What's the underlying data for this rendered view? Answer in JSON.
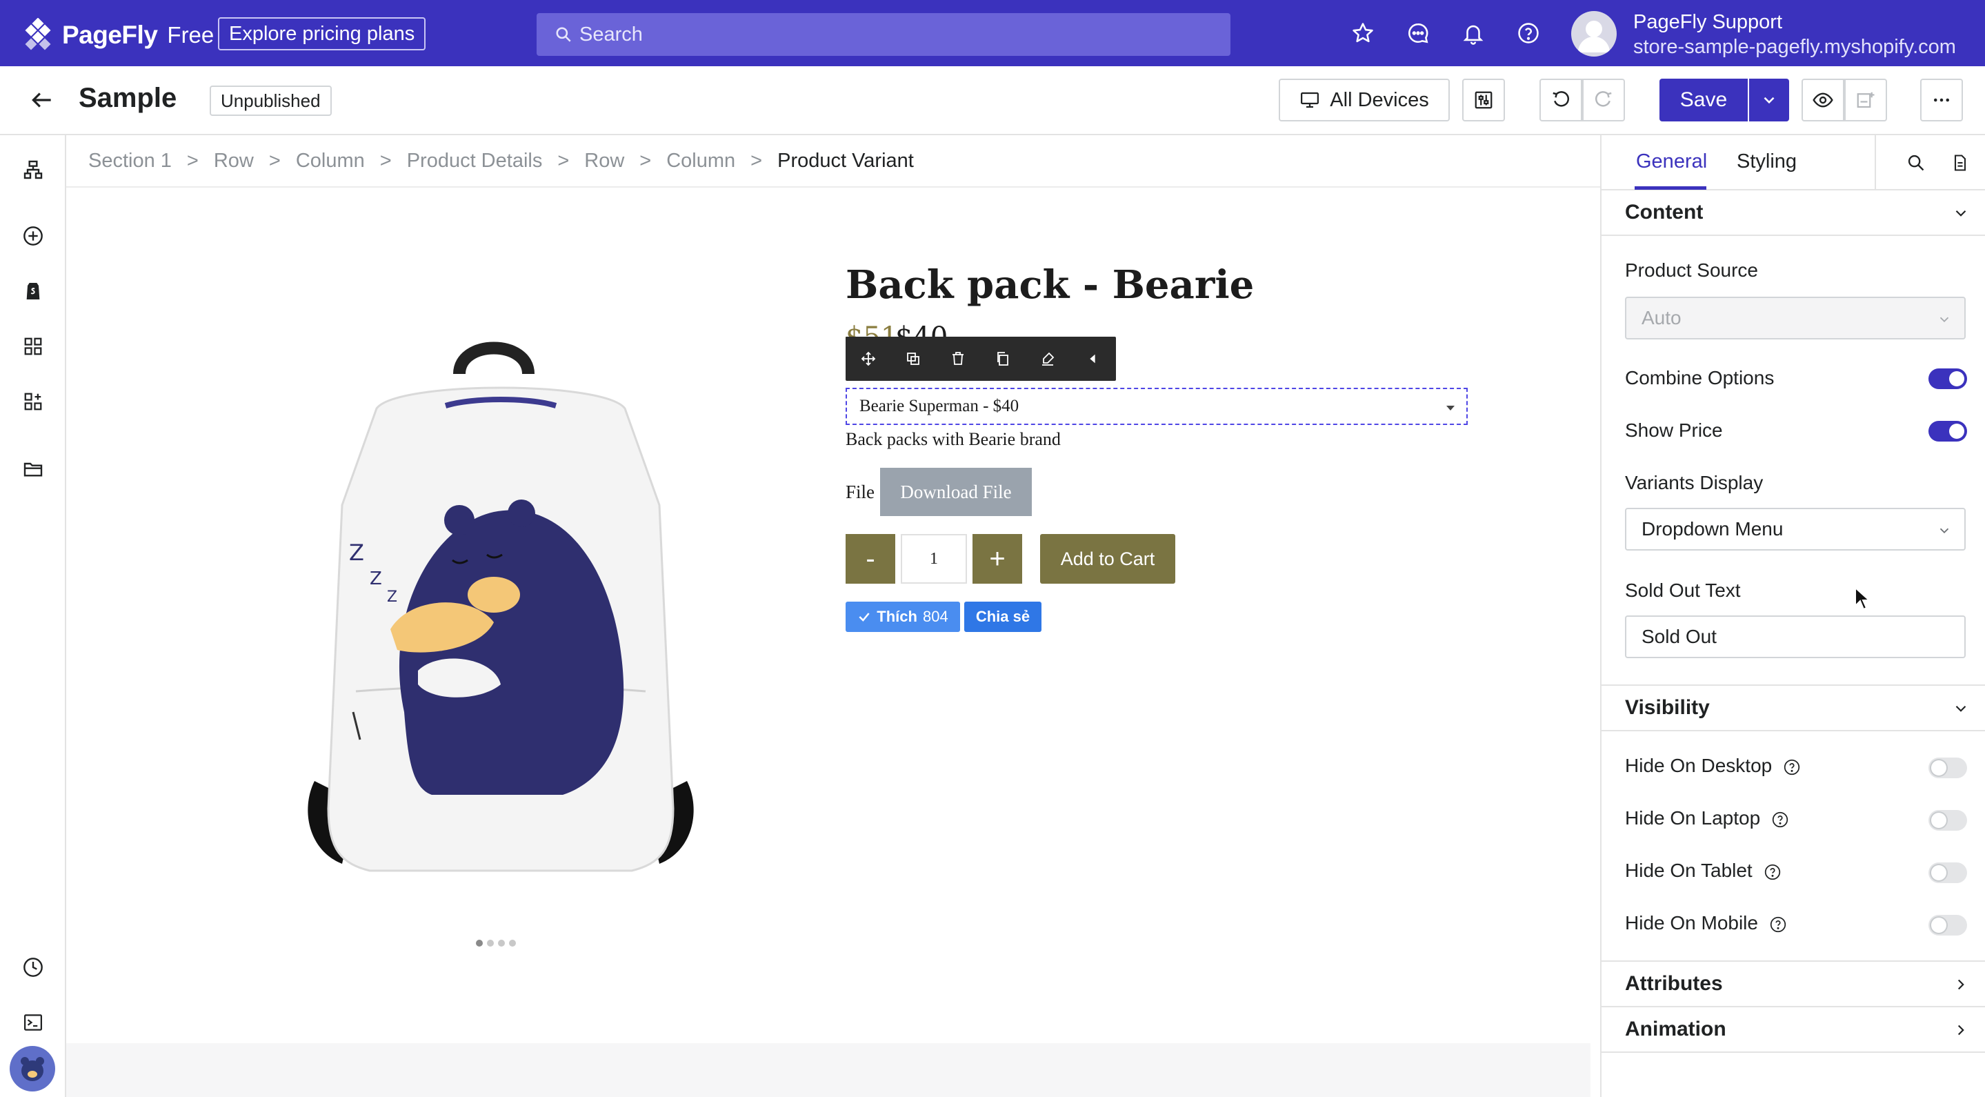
{
  "topbar": {
    "logo_name": "PageFly",
    "logo_plan": "Free",
    "pricing_label": "Explore pricing plans",
    "search_placeholder": "Search",
    "user_name": "PageFly Support",
    "user_store": "store-sample-pagefly.myshopify.com",
    "icons": [
      "star-icon",
      "chat-icon",
      "bell-icon",
      "help-icon"
    ]
  },
  "secondbar": {
    "title": "Sample",
    "status": "Unpublished",
    "devices_label": "All Devices",
    "save_label": "Save"
  },
  "breadcrumb": [
    "Section 1",
    "Row",
    "Column",
    "Product Details",
    "Row",
    "Column",
    "Product Variant"
  ],
  "breadcrumb_sep": ">",
  "product": {
    "title": "Back pack - Bearie",
    "price_old": "$51",
    "price_new": "$40",
    "variant_selected": "Bearie Superman - $40",
    "description": "Back packs with Bearie brand",
    "file_label": "File",
    "download_label": "Download File",
    "qty_minus": "-",
    "qty_value": "1",
    "qty_plus": "+",
    "add_to_cart": "Add to Cart",
    "like_label": "Thích",
    "like_count": "804",
    "share_label": "Chia sẻ"
  },
  "panel": {
    "tab_general": "General",
    "tab_styling": "Styling",
    "content_title": "Content",
    "product_source_label": "Product Source",
    "product_source_value": "Auto",
    "combine_options_label": "Combine Options",
    "combine_options_on": true,
    "show_price_label": "Show Price",
    "show_price_on": true,
    "variants_display_label": "Variants Display",
    "variants_display_value": "Dropdown Menu",
    "sold_out_label": "Sold Out Text",
    "sold_out_value": "Sold Out",
    "visibility_title": "Visibility",
    "hide_desktop": "Hide On Desktop",
    "hide_laptop": "Hide On Laptop",
    "hide_tablet": "Hide On Tablet",
    "hide_mobile": "Hide On Mobile",
    "attributes_title": "Attributes",
    "animation_title": "Animation"
  },
  "colors": {
    "brand": "#3b32bd",
    "olive": "#7a7442",
    "facebook": "#4a8df0"
  }
}
